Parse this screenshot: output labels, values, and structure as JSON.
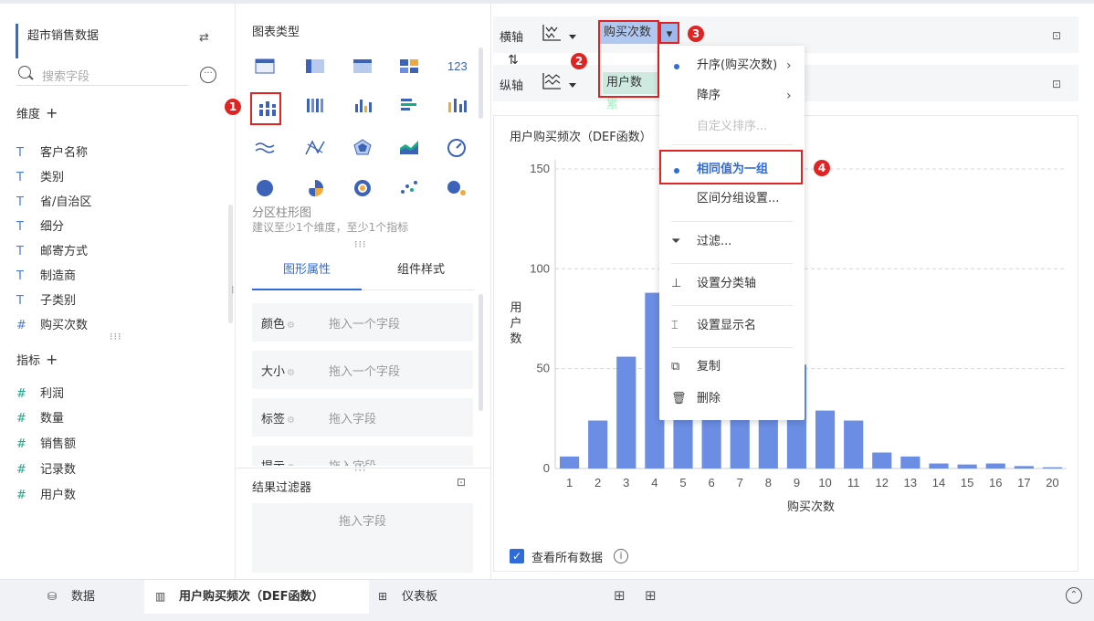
{
  "datasource": {
    "title": "超市销售数据"
  },
  "search": {
    "placeholder": "搜索字段"
  },
  "dimensions": {
    "label": "维度",
    "items": [
      "客户名称",
      "类别",
      "省/自治区",
      "细分",
      "邮寄方式",
      "制造商",
      "子类别",
      "购买次数"
    ]
  },
  "measures": {
    "label": "指标",
    "items": [
      "利润",
      "数量",
      "销售额",
      "记录数",
      "用户数"
    ]
  },
  "chart_types": {
    "title": "图表类型",
    "selected_name": "分区柱形图",
    "hint": "建议至少1个维度，至少1个指标"
  },
  "tabs": {
    "active": "图形属性",
    "other": "组件样式"
  },
  "properties": [
    {
      "label": "颜色",
      "value": "拖入一个字段"
    },
    {
      "label": "大小",
      "value": "拖入一个字段"
    },
    {
      "label": "标签",
      "value": "拖入字段"
    },
    {
      "label": "提示",
      "value": "拖入字段"
    }
  ],
  "result_filter": {
    "title": "结果过滤器",
    "drop": "拖入字段"
  },
  "axes": {
    "x_label": "横轴",
    "y_label": "纵轴",
    "x_field": "购买次数",
    "y_field": "用户数",
    "y_sub": "累"
  },
  "menu": {
    "items": [
      {
        "label": "升序(购买次数)",
        "bullet": true,
        "arrow": true,
        "state": "normal"
      },
      {
        "label": "降序",
        "bullet": false,
        "arrow": true,
        "state": "normal"
      },
      {
        "label": "自定义排序...",
        "bullet": false,
        "arrow": false,
        "state": "disabled"
      },
      {
        "label": "相同值为一组",
        "bullet": true,
        "arrow": false,
        "state": "active"
      },
      {
        "label": "区间分组设置...",
        "bullet": false,
        "arrow": false,
        "state": "normal"
      },
      {
        "label": "过滤...",
        "icon": "filter-icon",
        "state": "normal"
      },
      {
        "label": "设置分类轴",
        "icon": "axis-icon",
        "state": "normal"
      },
      {
        "label": "设置显示名",
        "icon": "rename-icon",
        "state": "normal"
      },
      {
        "label": "复制",
        "icon": "copy-icon",
        "state": "normal"
      },
      {
        "label": "删除",
        "icon": "trash-icon",
        "state": "normal"
      }
    ]
  },
  "badges": [
    "1",
    "2",
    "3",
    "4"
  ],
  "chart": {
    "check_label": "查看所有数据"
  },
  "chart_data": {
    "type": "bar",
    "title": "用户购买频次（DEF函数）",
    "xlabel": "购买次数",
    "ylabel": "用户数",
    "categories": [
      "1",
      "2",
      "3",
      "4",
      "5",
      "6",
      "7",
      "8",
      "9",
      "10",
      "11",
      "12",
      "13",
      "14",
      "15",
      "16",
      "17",
      "20"
    ],
    "values": [
      6,
      24,
      56,
      88,
      62,
      52,
      45,
      48,
      52,
      29,
      24,
      8,
      6,
      2.5,
      2,
      2.5,
      1.2,
      0.6
    ],
    "yticks": [
      0,
      50,
      100,
      150
    ],
    "ylim": [
      0,
      150
    ],
    "bar_color": "#6b8de3"
  },
  "bottom": {
    "tabs": [
      "数据",
      "用户购买频次（DEF函数）",
      "仪表板"
    ]
  },
  "colors": {
    "accent": "#2f6bd9",
    "highlight": "#e02424"
  }
}
